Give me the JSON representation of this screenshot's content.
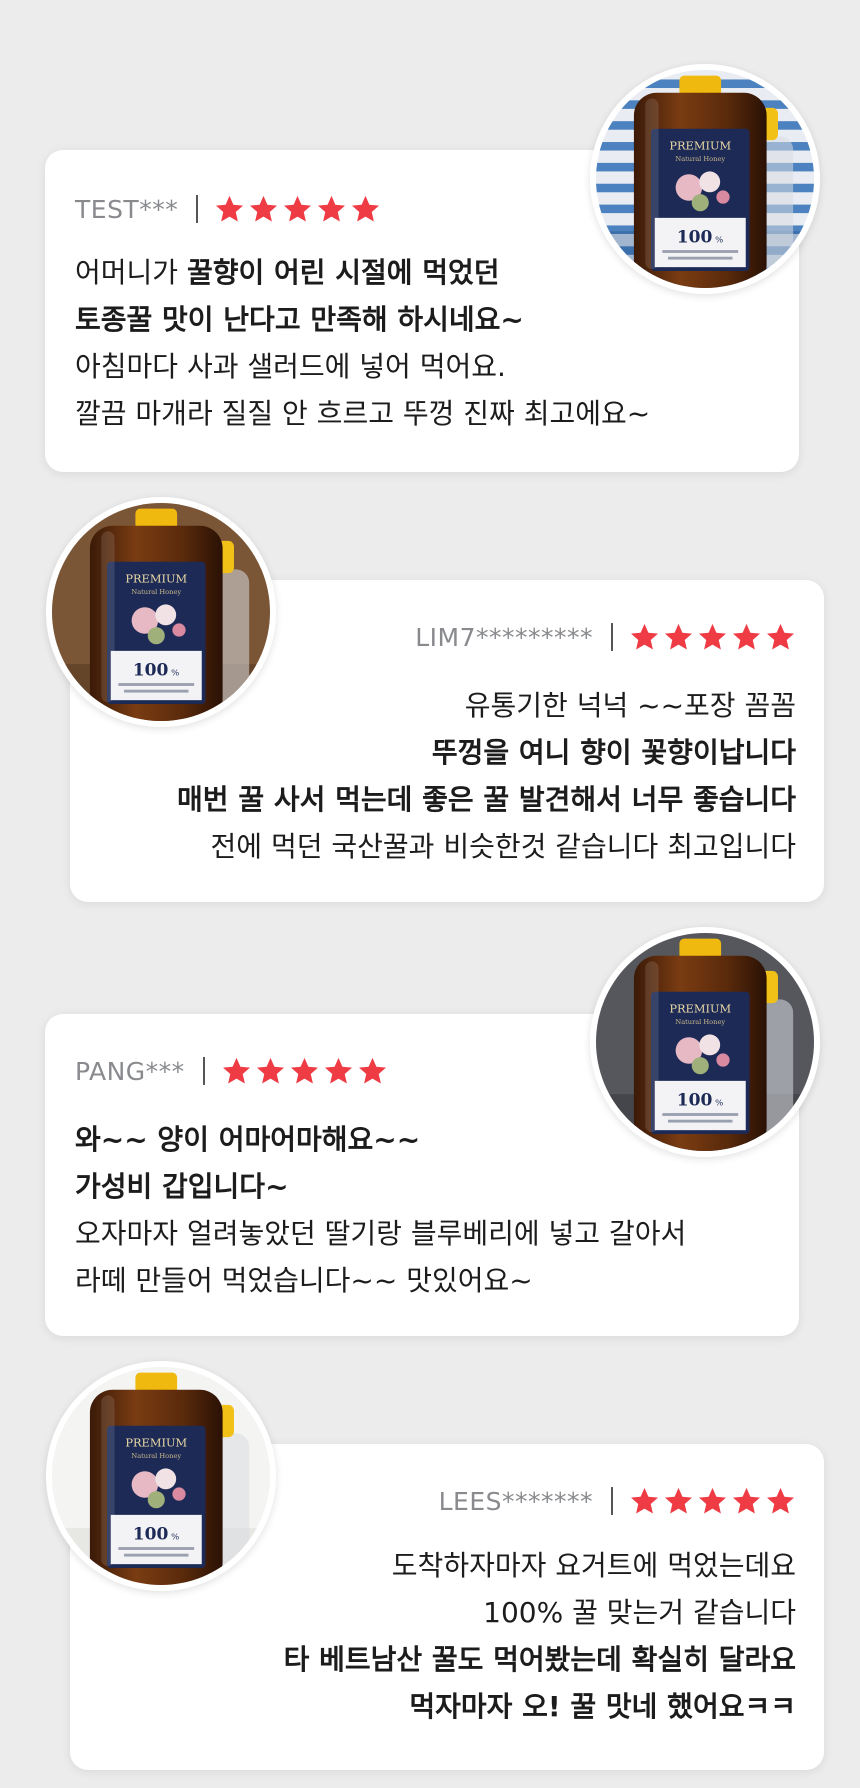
{
  "colors": {
    "background": "#ececed",
    "card": "#ffffff",
    "star": "#ee3b44",
    "username": "#888a8e"
  },
  "reviews": [
    {
      "user": "TEST***",
      "rating": 5,
      "align": "left",
      "photo_icon": "honey-bottle-photo",
      "lines": [
        {
          "text": "어머니가 ",
          "bold": false,
          "text2": "꿀향이 어린 시절에 먹었던"
        },
        {
          "text": "토종꿀 맛이 난다고 만족해 하시네요~",
          "bold": true
        },
        {
          "text": "아침마다 사과 샐러드에 넣어 먹어요.",
          "bold": false
        },
        {
          "text": "깔끔 마개라 질질 안 흐르고 뚜껑 진짜 최고에요~",
          "bold": false
        }
      ]
    },
    {
      "user": "LIM7*********",
      "rating": 5,
      "align": "right",
      "photo_icon": "honey-bottle-photo",
      "lines": [
        {
          "text": "유통기한 넉넉 ~~포장 꼼꼼",
          "bold": false
        },
        {
          "text": "뚜껑을 여니 향이 꽃향이납니다",
          "bold": true
        },
        {
          "text": "매번 꿀 사서 먹는데 좋은 꿀 발견해서 너무 좋습니다",
          "bold": true
        },
        {
          "text": "전에 먹던 국산꿀과 비슷한것 같습니다 최고입니다",
          "bold": false
        }
      ]
    },
    {
      "user": "PANG***",
      "rating": 5,
      "align": "left",
      "photo_icon": "honey-bottle-photo",
      "lines": [
        {
          "text": "와~~ 양이 어마어마해요~~",
          "bold": true
        },
        {
          "text": "가성비 갑입니다~",
          "bold": true
        },
        {
          "text": "오자마자 얼려놓았던 딸기랑 블루베리에 넣고 갈아서",
          "bold": false
        },
        {
          "text": "라떼 만들어 먹었습니다~~ 맛있어요~",
          "bold": false
        }
      ]
    },
    {
      "user": "LEES*******",
      "rating": 5,
      "align": "right",
      "photo_icon": "honey-bottle-photo",
      "lines": [
        {
          "text": "도착하자마자 요거트에 먹었는데요",
          "bold": false
        },
        {
          "text": "100% 꿀 맞는거 같습니다",
          "bold": false
        },
        {
          "text": "타 베트남산 꿀도 먹어봤는데 확실히 달라요",
          "bold": true
        },
        {
          "text": "먹자마자 오! 꿀 맛네 했어요ㅋㅋ",
          "bold": true
        }
      ]
    }
  ],
  "label": {
    "brand": "PREMIUM",
    "sub": "Natural Honey",
    "percent": "100",
    "percent_sign": "%"
  }
}
